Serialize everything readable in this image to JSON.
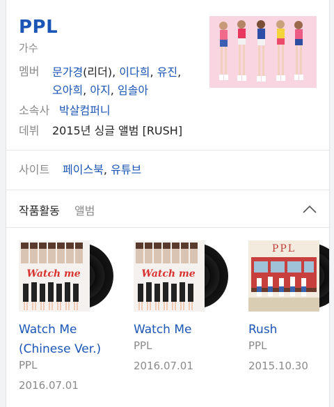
{
  "header": {
    "name": "PPL",
    "occupation": "가수"
  },
  "info": {
    "members_label": "멤버",
    "members": [
      {
        "name": "문가경"
      },
      {
        "name": "이다희"
      },
      {
        "name": "유진"
      },
      {
        "name": "오아희"
      },
      {
        "name": "아지"
      },
      {
        "name": "임솔아"
      }
    ],
    "leader_note": "(리더)",
    "agency_label": "소속사",
    "agency": "박살컴퍼니",
    "debut_label": "데뷔",
    "debut": "2015년 싱글 앨범 [RUSH]",
    "site_label": "사이트",
    "sites": [
      "페이스북",
      "유튜브"
    ]
  },
  "works": {
    "title": "작품활동",
    "subtitle": "앨범",
    "albums": [
      {
        "title_line1": "Watch Me",
        "title_line2": "(Chinese Ver.)",
        "artist": "PPL",
        "date": "2016.07.01",
        "cover_text": "Watch me"
      },
      {
        "title_line1": "Watch Me",
        "title_line2": "",
        "artist": "PPL",
        "date": "2016.07.01",
        "cover_text": "Watch me"
      },
      {
        "title_line1": "Rush",
        "title_line2": "",
        "artist": "PPL",
        "date": "2015.10.30",
        "cover_text": "PPL"
      }
    ]
  },
  "colors": {
    "link": "#1b55b5",
    "muted": "#8a8a8a"
  }
}
